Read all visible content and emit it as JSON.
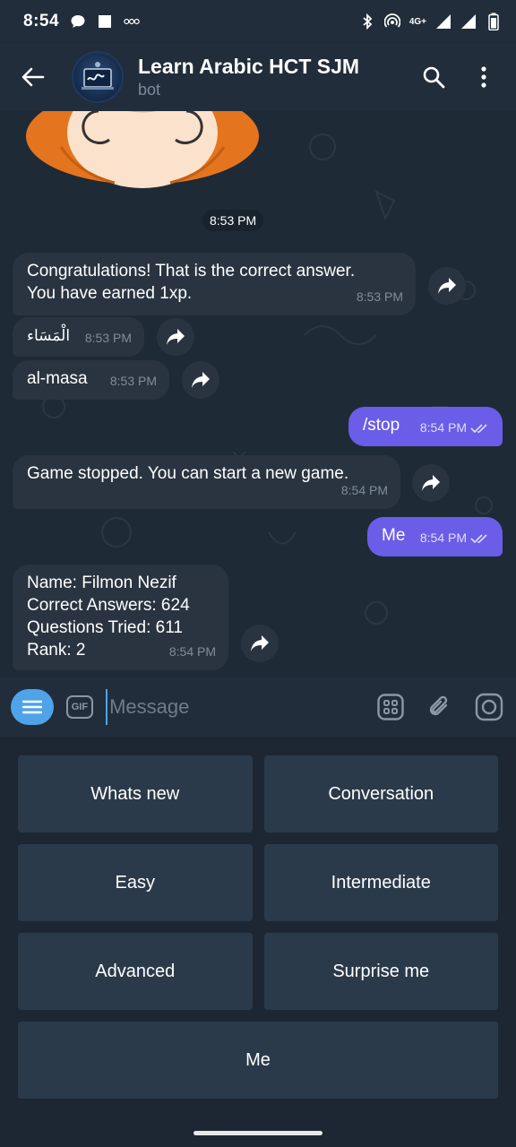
{
  "status_bar": {
    "time": "8:54",
    "network": "4G+"
  },
  "header": {
    "title": "Learn Arabic HCT SJM",
    "subtitle": "bot"
  },
  "sticker": {
    "time": "8:53 PM"
  },
  "messages": [
    {
      "direction": "in",
      "text": "Congratulations! That is the correct answer.\nYou have earned 1xp.",
      "time": "8:53 PM"
    },
    {
      "direction": "in",
      "text": "الْمَسَاء",
      "time": "8:53 PM"
    },
    {
      "direction": "in",
      "text": "al-masa",
      "time": "8:53 PM"
    },
    {
      "direction": "out",
      "text": "/stop",
      "time": "8:54 PM"
    },
    {
      "direction": "in",
      "text": "Game stopped. You can start a new game.",
      "time": "8:54 PM"
    },
    {
      "direction": "out",
      "text": "Me",
      "time": "8:54 PM"
    },
    {
      "direction": "in",
      "text": "Name: Filmon Nezif\nCorrect Answers: 624\nQuestions Tried: 611\nRank: 2",
      "time": "8:54 PM"
    }
  ],
  "input": {
    "placeholder": "Message",
    "gif_label": "GIF"
  },
  "keyboard": {
    "rows": [
      [
        "Whats new",
        "Conversation"
      ],
      [
        "Easy",
        "Intermediate"
      ],
      [
        "Advanced",
        "Surprise me"
      ],
      [
        "Me"
      ]
    ]
  },
  "colors": {
    "accent": "#4fa3e8",
    "outgoing_bubble": "#6a5de8",
    "incoming_bubble": "#2a3441",
    "background": "#1e2a36"
  }
}
